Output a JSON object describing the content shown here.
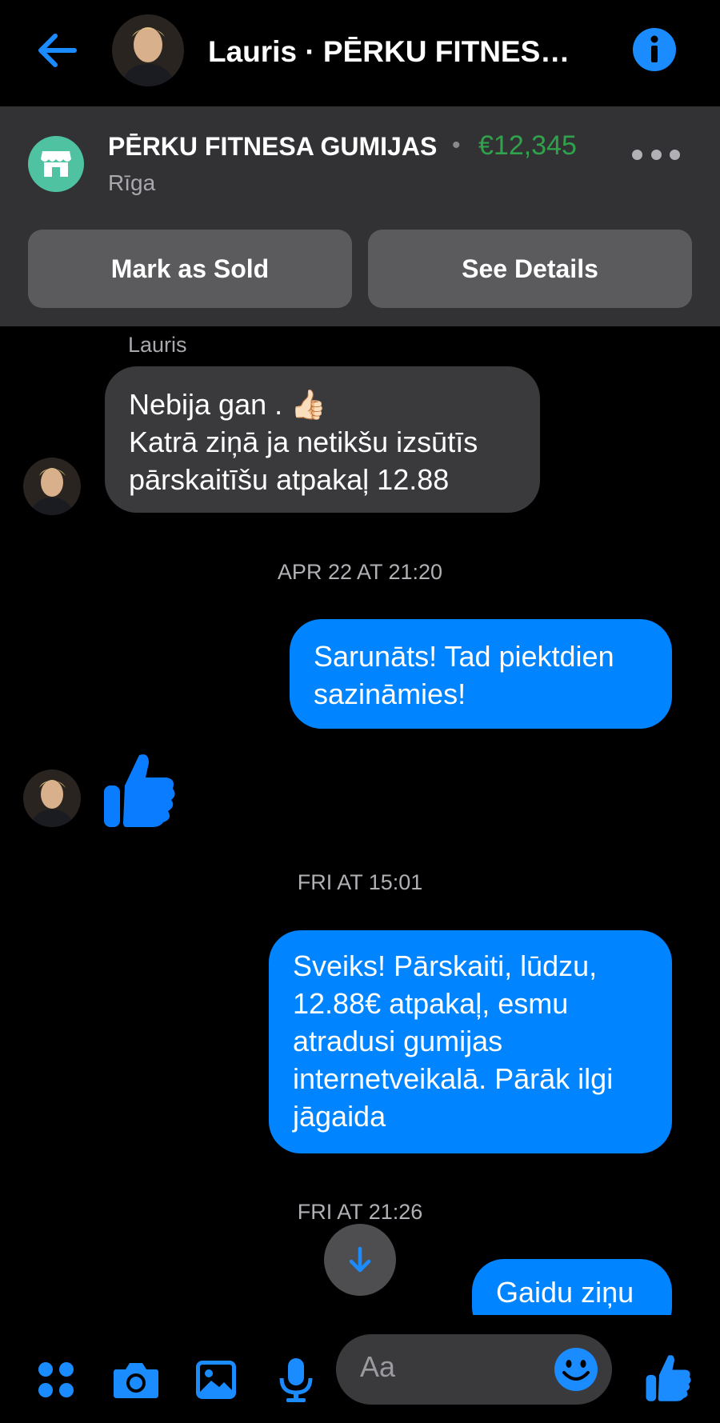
{
  "header": {
    "title": "Lauris · PĒRKU FITNESA GUMIJAS",
    "back_icon": "back-arrow-icon",
    "info_icon": "info-icon"
  },
  "listing": {
    "title": "PĒRKU FITNESA GUMIJAS",
    "separator": "•",
    "price": "€12,345",
    "location": "Rīga",
    "mark_sold_label": "Mark as Sold",
    "see_details_label": "See Details",
    "store_icon": "storefront-icon",
    "more_icon": "more-options-icon"
  },
  "messages": {
    "sender_name": "Lauris",
    "incoming_1": {
      "line1": "Nebija gan . 👍🏻",
      "line2": "Katrā ziņā ja netikšu izsūtīs",
      "line3": "pārskaitīšu atpakaļ 12.88"
    },
    "timestamp_1": "APR 22 AT 21:20",
    "outgoing_1": {
      "line1": "Sarunāts! Tad piektdien",
      "line2": "sazināmies!"
    },
    "timestamp_2": "FRI AT 15:01",
    "outgoing_2": {
      "line1": "Sveiks! Pārskaiti, lūdzu,",
      "line2": "12.88€ atpakaļ, esmu",
      "line3": "atradusi gumijas",
      "line4": "internetveikalā. Pārāk ilgi",
      "line5": "jāgaida"
    },
    "timestamp_3": "FRI AT 21:26",
    "outgoing_3": "Gaidu ziņu"
  },
  "composer": {
    "placeholder": "Aa",
    "icons": [
      "apps-icon",
      "camera-icon",
      "gallery-icon",
      "microphone-icon",
      "emoji-icon",
      "thumbs-up-icon"
    ]
  },
  "colors": {
    "accent": "#0084ff",
    "price": "#31a24c",
    "panel": "#323234",
    "bubble_incoming": "#3a3a3c"
  }
}
